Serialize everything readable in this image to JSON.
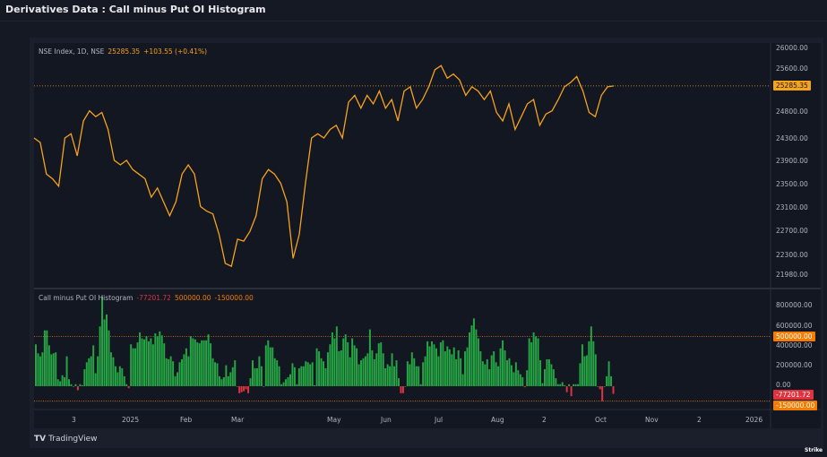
{
  "page_title": "Derivatives Data : Call minus Put OI Histogram",
  "branding": {
    "tradingview": "TradingView",
    "watermark": "Strike"
  },
  "colors": {
    "price_line": "#f7a21b",
    "bar_up": "#26a544",
    "bar_down": "#e0323f",
    "level_line": "#f57c00"
  },
  "chart_data": [
    {
      "type": "line",
      "title": "NSE Index, 1D, NSE",
      "last_value": "25285.35",
      "change": "+103.55 (+0.41%)",
      "y_ticks": [
        "26000.00",
        "25600.00",
        "24800.00",
        "24300.00",
        "23900.00",
        "23500.00",
        "23100.00",
        "22700.00",
        "22300.00",
        "21980.00"
      ],
      "ylim": [
        21980,
        26000
      ],
      "values": [
        24316,
        24236,
        23680,
        23600,
        23473,
        24316,
        24395,
        23998,
        24633,
        24824,
        24713,
        24792,
        24475,
        23918,
        23839,
        23918,
        23759,
        23680,
        23600,
        23283,
        23442,
        23203,
        22965,
        23203,
        23680,
        23839,
        23680,
        23123,
        23044,
        22997,
        22647,
        22170,
        22123,
        22568,
        22536,
        22695,
        22965,
        23600,
        23759,
        23680,
        23521,
        23203,
        22250,
        22647,
        23521,
        24316,
        24395,
        24316,
        24475,
        24554,
        24316,
        24983,
        25110,
        24872,
        25110,
        24951,
        25190,
        24872,
        25031,
        24633,
        25190,
        25269,
        24872,
        25031,
        25269,
        25587,
        25666,
        25428,
        25507,
        25396,
        25110,
        25269,
        25190,
        25031,
        25190,
        24792,
        24633,
        24951,
        24475,
        24713,
        24951,
        25031,
        24554,
        24761,
        24824,
        25031,
        25269,
        25349,
        25460,
        25190,
        24792,
        24713,
        25110,
        25269,
        25285.35
      ]
    },
    {
      "type": "bar",
      "title": "Call minus Put OI Histogram",
      "last_value": "-77201.72",
      "upper_level": "500000.00",
      "lower_level": "-150000.00",
      "y_ticks": [
        "800000.00",
        "600000.00",
        "400000.00",
        "200000.00",
        "0.00"
      ],
      "values_thousands": [
        420,
        330,
        300,
        340,
        560,
        560,
        410,
        320,
        330,
        340,
        70,
        50,
        110,
        90,
        300,
        70,
        20,
        0,
        20,
        -40,
        20,
        10,
        170,
        240,
        280,
        300,
        410,
        130,
        300,
        600,
        900,
        670,
        720,
        560,
        340,
        290,
        200,
        140,
        200,
        180,
        100,
        20,
        -20,
        420,
        380,
        380,
        440,
        540,
        480,
        470,
        500,
        450,
        480,
        420,
        530,
        500,
        550,
        510,
        430,
        280,
        270,
        300,
        250,
        100,
        140,
        240,
        270,
        320,
        380,
        300,
        500,
        480,
        470,
        440,
        430,
        460,
        460,
        460,
        520,
        430,
        280,
        240,
        230,
        100,
        70,
        90,
        210,
        100,
        140,
        190,
        260,
        0,
        -70,
        -60,
        -50,
        -30,
        -70,
        80,
        260,
        180,
        180,
        300,
        200,
        0,
        410,
        460,
        390,
        390,
        280,
        260,
        200,
        20,
        40,
        70,
        90,
        120,
        230,
        190,
        20,
        180,
        200,
        200,
        250,
        240,
        220,
        240,
        10,
        380,
        350,
        280,
        250,
        180,
        340,
        420,
        540,
        480,
        600,
        350,
        360,
        480,
        520,
        440,
        290,
        480,
        410,
        380,
        220,
        260,
        280,
        300,
        330,
        570,
        360,
        270,
        330,
        430,
        440,
        330,
        180,
        220,
        200,
        330,
        200,
        260,
        80,
        -70,
        -70,
        0,
        250,
        220,
        340,
        280,
        200,
        200,
        20,
        240,
        300,
        450,
        400,
        450,
        420,
        380,
        300,
        440,
        460,
        350,
        400,
        370,
        320,
        390,
        270,
        360,
        280,
        120,
        350,
        390,
        540,
        610,
        680,
        570,
        480,
        350,
        250,
        220,
        270,
        170,
        310,
        350,
        240,
        200,
        380,
        460,
        360,
        260,
        280,
        210,
        140,
        240,
        160,
        120,
        90,
        -10,
        160,
        480,
        440,
        540,
        500,
        480,
        260,
        30,
        170,
        270,
        270,
        220,
        170,
        80,
        20,
        20,
        40,
        10,
        -60,
        20,
        -100,
        20,
        20,
        20,
        230,
        420,
        300,
        310,
        450,
        600,
        450,
        320,
        0,
        -30,
        -150,
        0,
        100,
        250,
        100,
        -77
      ]
    }
  ],
  "x_axis": {
    "labels": [
      "3",
      "2025",
      "Feb",
      "Mar",
      "May",
      "Jun",
      "Jul",
      "Aug",
      "2",
      "Oct",
      "Nov",
      "2",
      "2026"
    ]
  }
}
